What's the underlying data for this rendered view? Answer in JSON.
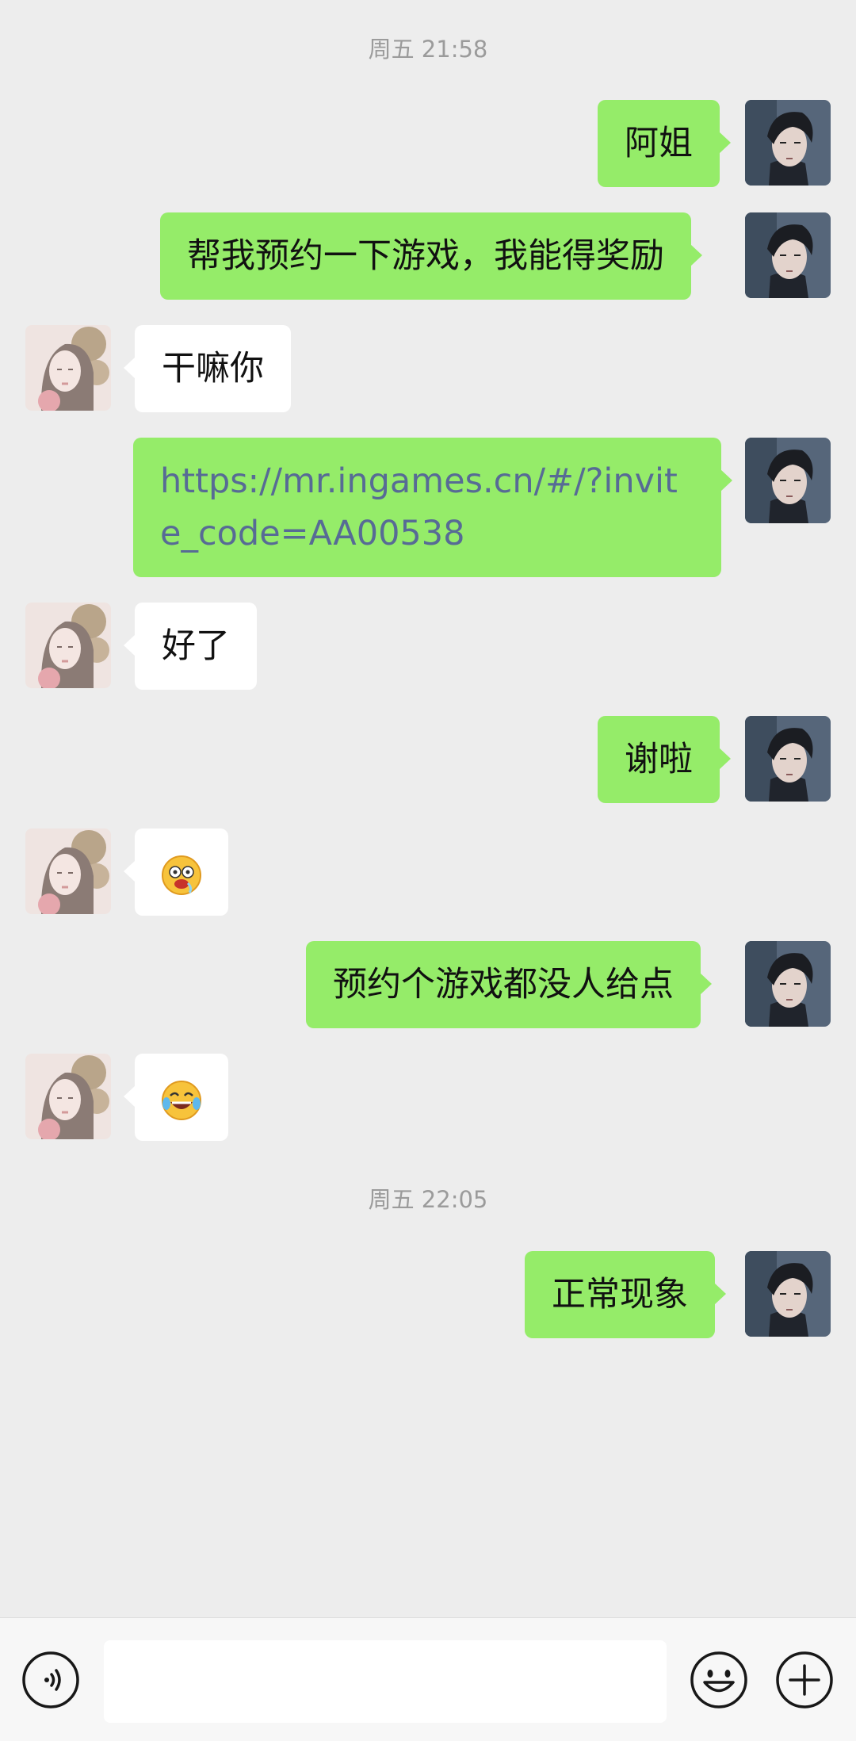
{
  "timestamps": [
    "周五 21:58",
    "周五 22:05"
  ],
  "messages": [
    {
      "from": "me",
      "text": "阿姐"
    },
    {
      "from": "me",
      "text": "帮我预约一下游戏，我能得奖励"
    },
    {
      "from": "other",
      "text": "干嘛你"
    },
    {
      "from": "me",
      "text": "https://mr.ingames.cn/#/?invite_code=AA00538"
    },
    {
      "from": "other",
      "text": "好了"
    },
    {
      "from": "me",
      "text": "谢啦"
    },
    {
      "from": "other",
      "emoji": "drooling-face-emoji"
    },
    {
      "from": "me",
      "text": "预约个游戏都没人给点"
    },
    {
      "from": "other",
      "emoji": "tears-of-joy-emoji"
    },
    {
      "from": "me",
      "text": "正常现象"
    }
  ],
  "input": {
    "value": "",
    "placeholder": ""
  },
  "icons": {
    "voice": "voice-input-icon",
    "emoji": "emoji-panel-icon",
    "more": "plus-more-icon"
  },
  "colors": {
    "background": "#ededed",
    "my_bubble": "#95ec69",
    "other_bubble": "#ffffff",
    "link_text": "#576b95",
    "timestamp_text": "#9b9b9b"
  }
}
